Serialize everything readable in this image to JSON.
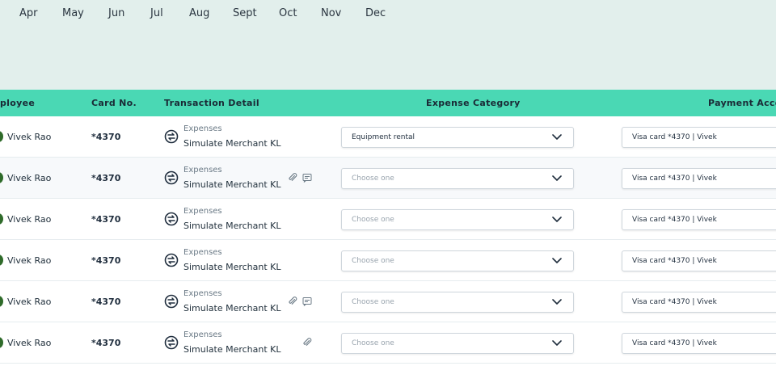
{
  "timeline": {
    "months": [
      "Apr",
      "May",
      "Jun",
      "Jul",
      "Aug",
      "Sept",
      "Oct",
      "Nov",
      "Dec"
    ]
  },
  "table": {
    "headers": {
      "employee": "ployee",
      "card_no": "Card No.",
      "transaction_detail": "Transaction Detail",
      "expense_category": "Expense Category",
      "payment_account": "Payment Accou"
    },
    "rows": [
      {
        "employee": "Vivek Rao",
        "card": "*4370",
        "type": "Expenses",
        "merchant": "Simulate Merchant KL",
        "category": "Equipment rental",
        "payment": "Visa card *4370 | Vivek"
      },
      {
        "employee": "Vivek Rao",
        "card": "*4370",
        "type": "Expenses",
        "merchant": "Simulate Merchant KL",
        "category": "Choose one",
        "payment": "Visa card *4370 | Vivek"
      },
      {
        "employee": "Vivek Rao",
        "card": "*4370",
        "type": "Expenses",
        "merchant": "Simulate Merchant KL",
        "category": "Choose one",
        "payment": "Visa card *4370 | Vivek"
      },
      {
        "employee": "Vivek Rao",
        "card": "*4370",
        "type": "Expenses",
        "merchant": "Simulate Merchant KL",
        "category": "Choose one",
        "payment": "Visa card *4370 | Vivek"
      },
      {
        "employee": "Vivek Rao",
        "card": "*4370",
        "type": "Expenses",
        "merchant": "Simulate Merchant KL",
        "category": "Choose one",
        "payment": "Visa card *4370 | Vivek"
      },
      {
        "employee": "Vivek Rao",
        "card": "*4370",
        "type": "Expenses",
        "merchant": "Simulate Merchant KL",
        "category": "Choose one",
        "payment": "Visa card *4370 | Vivek"
      }
    ]
  },
  "icons": {
    "transaction": "exchange-icon",
    "attachment": "paperclip-icon",
    "note": "note-icon",
    "dropdown": "chevron-down-icon"
  },
  "colors": {
    "header_bg": "#4ad8b4",
    "timeline_bg": "#e2efec",
    "avatar": "#2f6b2a"
  }
}
